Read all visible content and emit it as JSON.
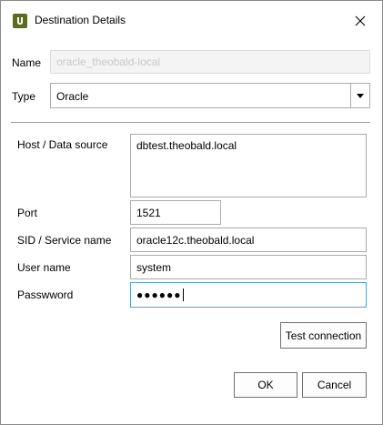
{
  "window": {
    "title": "Destination Details",
    "icon": "app-logo-icon",
    "close_icon": "close-icon"
  },
  "form": {
    "name_label": "Name",
    "name_value": "oracle_theobald-local",
    "type_label": "Type",
    "type_value": "Oracle",
    "host_label": "Host / Data source",
    "host_value": "dbtest.theobald.local",
    "port_label": "Port",
    "port_value": "1521",
    "sid_label": "SID / Service name",
    "sid_value": "oracle12c.theobald.local",
    "user_label": "User name",
    "user_value": "system",
    "password_label": "Passwword",
    "password_mask": "●●●●●●"
  },
  "buttons": {
    "test_connection": "Test connection",
    "ok": "OK",
    "cancel": "Cancel"
  }
}
